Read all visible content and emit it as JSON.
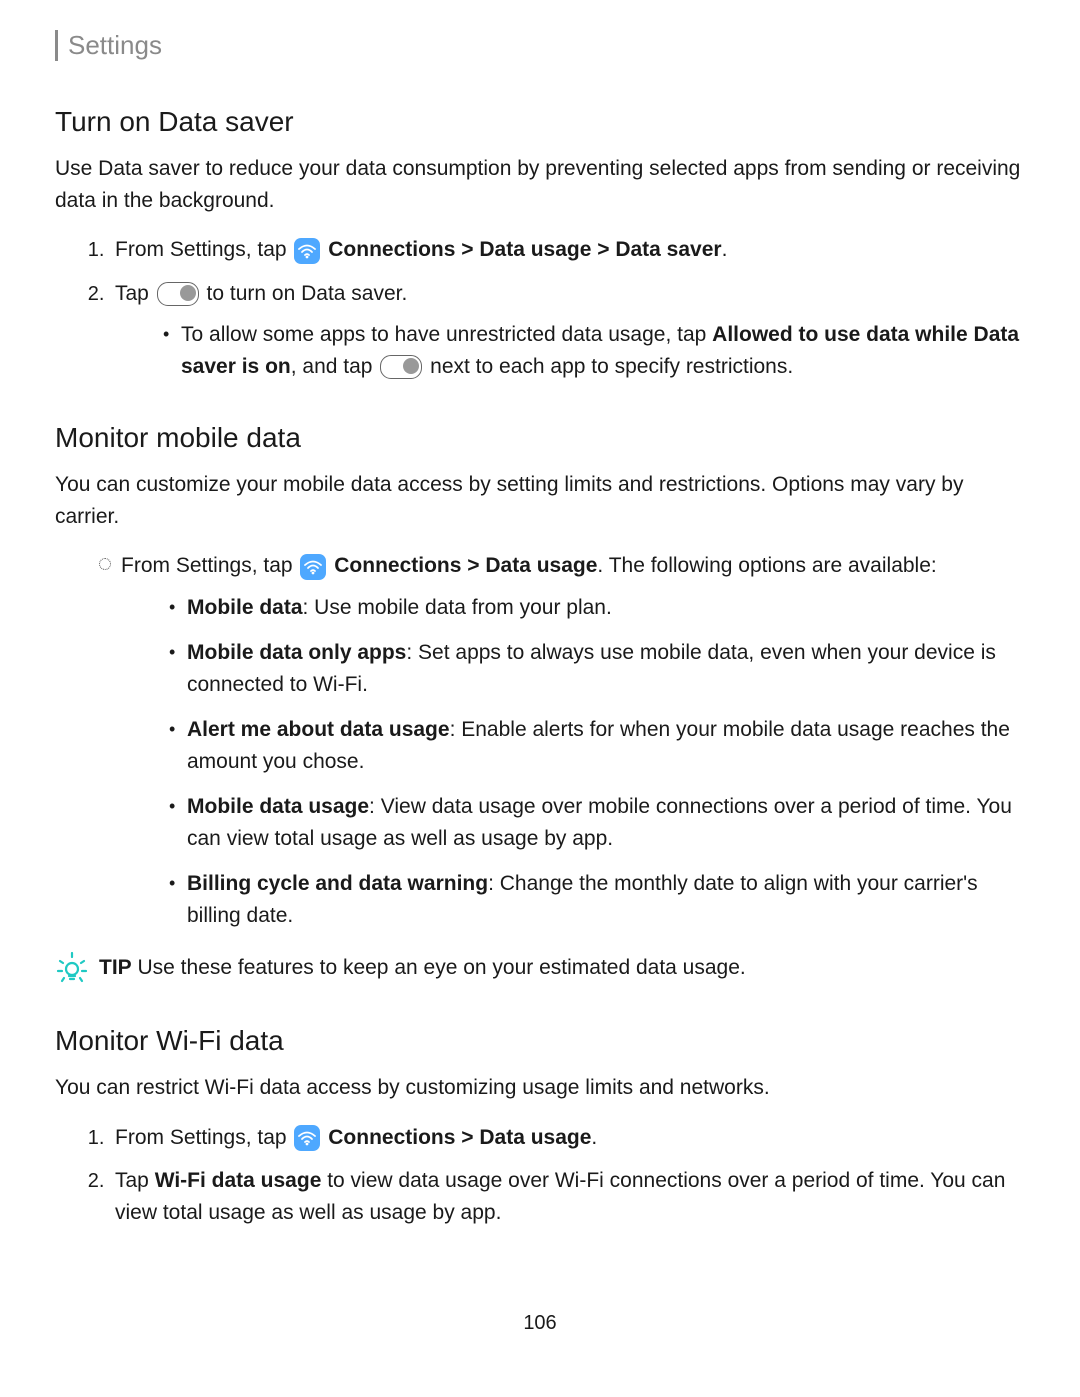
{
  "breadcrumb": "Settings",
  "section1": {
    "heading": "Turn on Data saver",
    "intro": "Use Data saver to reduce your data consumption by preventing selected apps from sending or receiving data in the background.",
    "step1_prefix": "From Settings, tap ",
    "step1_path": "Connections > Data usage > Data saver",
    "step1_suffix": ".",
    "step2_prefix": "Tap ",
    "step2_suffix": " to turn on Data saver.",
    "sub_prefix": "To allow some apps to have unrestricted data usage, tap ",
    "sub_bold1": "Allowed to use data while Data saver is on",
    "sub_mid": ", and tap ",
    "sub_suffix": " next to each app to specify restrictions."
  },
  "section2": {
    "heading": "Monitor mobile data",
    "intro": "You can customize your mobile data access by setting limits and restrictions. Options may vary by carrier.",
    "lead_prefix": "From Settings, tap ",
    "lead_path": "Connections > Data usage",
    "lead_suffix": ". The following options are available:",
    "opt1_b": "Mobile data",
    "opt1_t": ": Use mobile data from your plan.",
    "opt2_b": "Mobile data only apps",
    "opt2_t": ": Set apps to always use mobile data, even when your device is connected to Wi-Fi.",
    "opt3_b": "Alert me about data usage",
    "opt3_t": ": Enable alerts for when your mobile data usage reaches the amount you chose.",
    "opt4_b": "Mobile data usage",
    "opt4_t": ": View data usage over mobile connections over a period of time. You can view total usage as well as usage by app.",
    "opt5_b": "Billing cycle and data warning",
    "opt5_t": ": Change the monthly date to align with your carrier's billing date.",
    "tip_label": "TIP",
    "tip_text": "  Use these features to keep an eye on your estimated data usage."
  },
  "section3": {
    "heading": "Monitor Wi-Fi data",
    "intro": "You can restrict Wi-Fi data access by customizing usage limits and networks.",
    "step1_prefix": "From Settings, tap ",
    "step1_path": "Connections > Data usage",
    "step1_suffix": ".",
    "step2_prefix": "Tap ",
    "step2_bold": "Wi-Fi data usage",
    "step2_suffix": " to view data usage over Wi-Fi connections over a period of time. You can view total usage as well as usage by app."
  },
  "page_number": "106"
}
